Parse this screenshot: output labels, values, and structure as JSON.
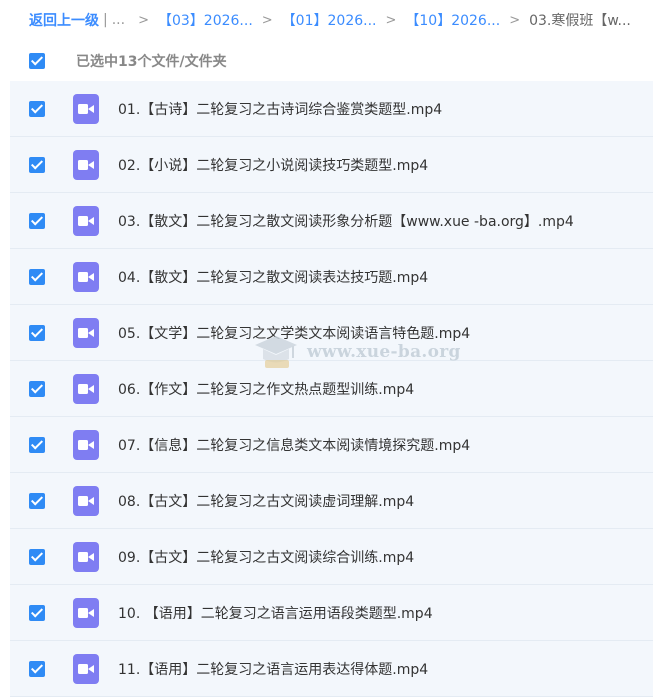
{
  "breadcrumb": {
    "back": "返回上一级",
    "divider": "|",
    "ellipsis": "...",
    "separator": ">",
    "items": [
      "【03】2026...",
      "【01】2026...",
      "【10】2026..."
    ],
    "current": "03.寒假班【w..."
  },
  "selection": {
    "label": "已选中13个文件/文件夹",
    "checkbox_color": "#2f8bf5"
  },
  "files": [
    {
      "name": "01.【古诗】二轮复习之古诗词综合鉴赏类题型.mp4"
    },
    {
      "name": "02.【小说】二轮复习之小说阅读技巧类题型.mp4"
    },
    {
      "name": "03.【散文】二轮复习之散文阅读形象分析题【www.xue -ba.org】.mp4"
    },
    {
      "name": "04.【散文】二轮复习之散文阅读表达技巧题.mp4"
    },
    {
      "name": "05.【文学】二轮复习之文学类文本阅读语言特色题.mp4"
    },
    {
      "name": "06.【作文】二轮复习之作文热点题型训练.mp4"
    },
    {
      "name": "07.【信息】二轮复习之信息类文本阅读情境探究题.mp4"
    },
    {
      "name": "08.【古文】二轮复习之古文阅读虚词理解.mp4"
    },
    {
      "name": "09.【古文】二轮复习之古文阅读综合训练.mp4"
    },
    {
      "name": "10. 【语用】二轮复习之语言运用语段类题型.mp4"
    },
    {
      "name": "11.【语用】二轮复习之语言运用表达得体题.mp4"
    }
  ],
  "file_icon": {
    "name": "video-file-icon",
    "color": "#7f7df2"
  },
  "watermark": {
    "text": "www.xue-ba.org"
  }
}
